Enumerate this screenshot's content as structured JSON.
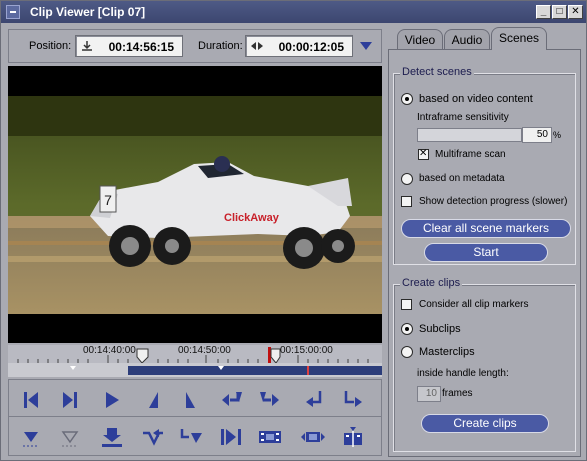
{
  "window": {
    "title": "Clip Viewer [Clip 07]",
    "minimize": "_",
    "maximize": "□",
    "close": "✕"
  },
  "position": {
    "label": "Position:",
    "value": "00:14:56:15"
  },
  "duration": {
    "label": "Duration:",
    "value": "00:00:12:05"
  },
  "video": {
    "car_number": "7",
    "sponsor": "ClickAway"
  },
  "timeline": {
    "ticks": [
      "00:14:40:00",
      "00:14:50:00",
      "00:15:00:00"
    ]
  },
  "tabs": [
    {
      "label": "Video",
      "active": false
    },
    {
      "label": "Audio",
      "active": false
    },
    {
      "label": "Scenes",
      "active": true
    }
  ],
  "detect_scenes": {
    "title": "Detect scenes",
    "based_on_video": "based on video content",
    "sensitivity_label": "Intraframe sensitivity",
    "sensitivity_value": "50",
    "sensitivity_unit": "%",
    "multiframe": "Multiframe scan",
    "based_on_metadata": "based on metadata",
    "show_progress": "Show detection progress (slower)",
    "clear_button": "Clear all scene markers",
    "start_button": "Start"
  },
  "create_clips": {
    "title": "Create clips",
    "consider_markers": "Consider all clip markers",
    "subclips": "Subclips",
    "masterclips": "Masterclips",
    "handle_label": "inside handle length:",
    "handle_value": "10",
    "handle_unit": "frames",
    "create_button": "Create clips"
  },
  "controls_row1": [
    "go-to-start-icon",
    "go-to-end-icon",
    "play-icon",
    "step-back-icon",
    "step-forward-icon",
    "set-mark-in-icon",
    "set-mark-out-icon",
    "go-to-mark-in-icon",
    "go-to-mark-out-icon"
  ],
  "controls_row2": [
    "add-marker-icon",
    "remove-marker-icon",
    "insert-icon",
    "extract-in-icon",
    "extract-out-icon",
    "play-in-out-icon",
    "film-clip-icon",
    "film-trim-icon",
    "split-clip-icon"
  ],
  "colors": {
    "accent": "#4a5aa4",
    "title_bar": "#4e5a86",
    "panel": "#a9aab2"
  }
}
